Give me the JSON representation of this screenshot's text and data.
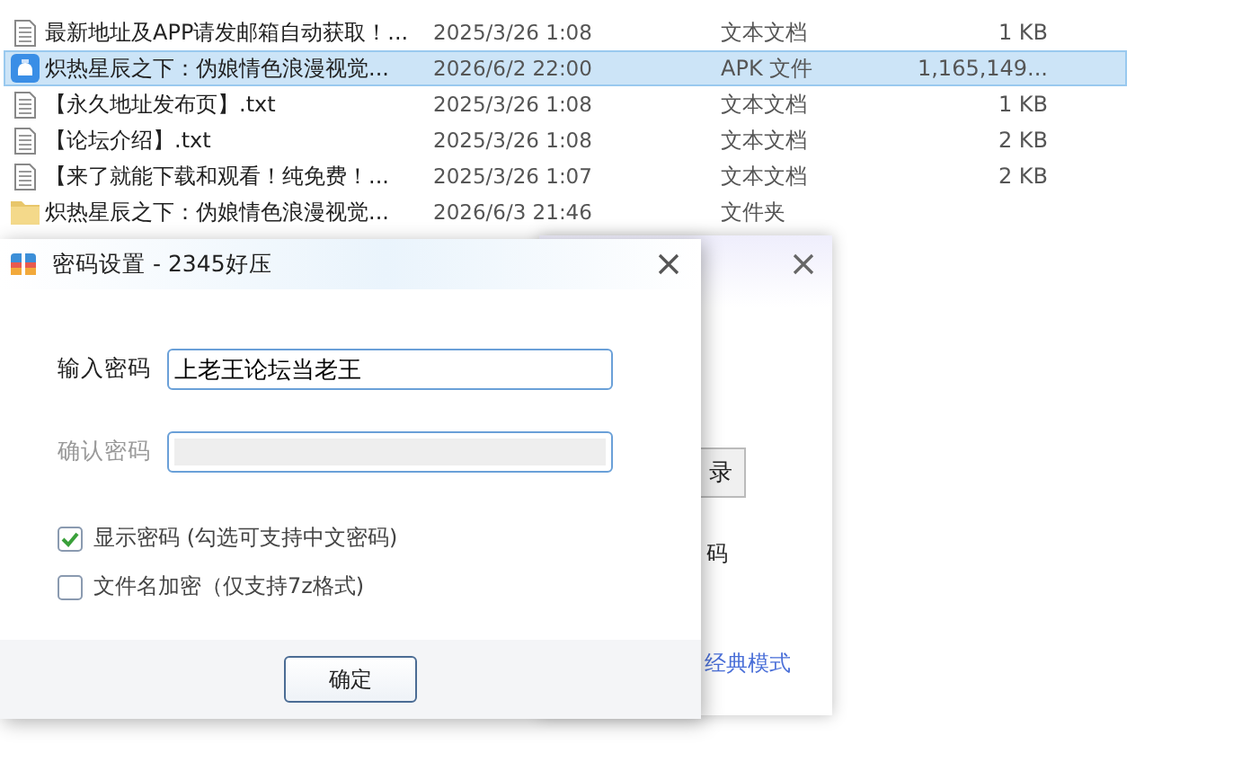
{
  "files": [
    {
      "kind": "text",
      "name": "最新地址及APP请发邮箱自动获取！...",
      "date": "2025/3/26 1:08",
      "type": "文本文档",
      "size": "1 KB",
      "selected": false
    },
    {
      "kind": "apk",
      "name": "炽热星辰之下：伪娘情色浪漫视觉...",
      "date": "2026/6/2 22:00",
      "type": "APK 文件",
      "size": "1,165,149...",
      "selected": true
    },
    {
      "kind": "text",
      "name": "【永久地址发布页】.txt",
      "date": "2025/3/26 1:08",
      "type": "文本文档",
      "size": "1 KB",
      "selected": false
    },
    {
      "kind": "text",
      "name": "【论坛介绍】.txt",
      "date": "2025/3/26 1:08",
      "type": "文本文档",
      "size": "2 KB",
      "selected": false
    },
    {
      "kind": "text",
      "name": "【来了就能下载和观看！纯免费！...",
      "date": "2025/3/26 1:07",
      "type": "文本文档",
      "size": "2 KB",
      "selected": false
    },
    {
      "kind": "folder",
      "name": "炽热星辰之下：伪娘情色浪漫视觉...",
      "date": "2026/6/3 21:46",
      "type": "文件夹",
      "selected": false
    }
  ],
  "back_dialog": {
    "button_fragment": "录",
    "text_fragment": "码",
    "link_fragment": "经典模式"
  },
  "dialog": {
    "title": "密码设置 - 2345好压",
    "fields": [
      {
        "label": "输入密码",
        "value": "上老王论坛当老王",
        "disabled": false
      },
      {
        "label": "确认密码",
        "disabled": true
      }
    ],
    "options": [
      {
        "label": "显示密码 (勾选可支持中文密码)",
        "checked": true
      },
      {
        "label": "文件名加密（仅支持7z格式)",
        "checked": false
      }
    ],
    "ok_button": "确定"
  }
}
